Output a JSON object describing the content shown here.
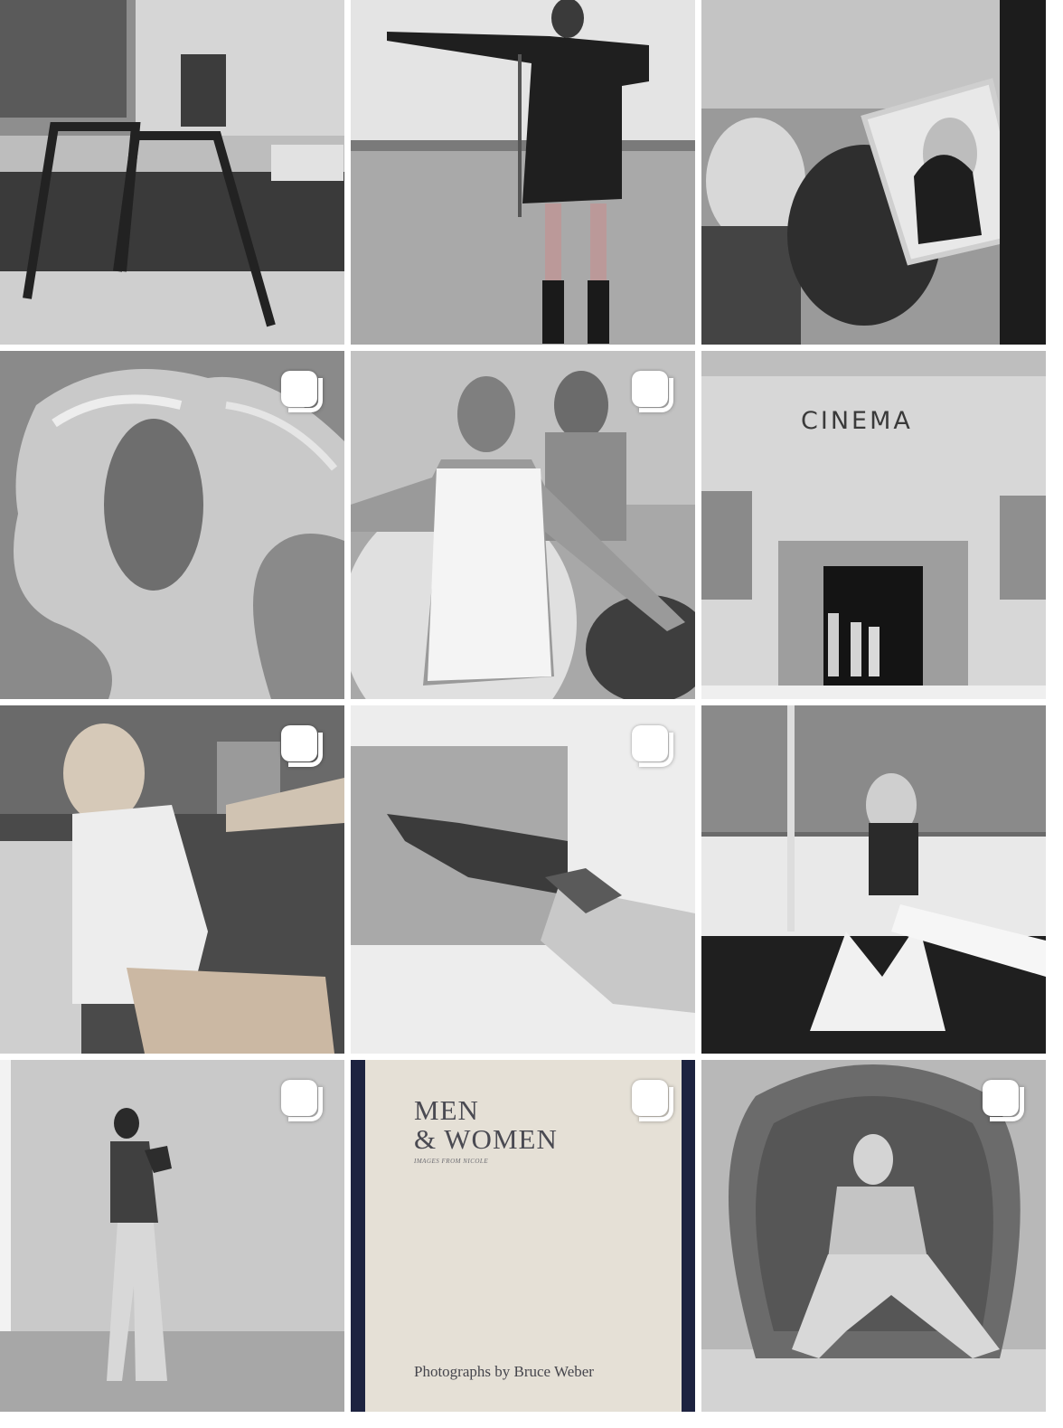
{
  "grid": {
    "tiles": [
      {
        "name": "photo-pool-ladder",
        "carousel": false
      },
      {
        "name": "photo-woman-field",
        "carousel": false
      },
      {
        "name": "photo-film-set-mirror",
        "carousel": false
      },
      {
        "name": "photo-sculpture",
        "carousel": true
      },
      {
        "name": "photo-pool-float",
        "carousel": true
      },
      {
        "name": "photo-cinema-facade",
        "carousel": false
      },
      {
        "name": "photo-woman-chair",
        "carousel": true
      },
      {
        "name": "photo-hands",
        "carousel": true
      },
      {
        "name": "photo-splash",
        "carousel": false
      },
      {
        "name": "photo-man-wall",
        "carousel": true
      },
      {
        "name": "photo-book-cover",
        "carousel": true
      },
      {
        "name": "photo-wicker-chair",
        "carousel": true
      }
    ]
  },
  "cinema": {
    "sign": "CINEMA"
  },
  "book": {
    "title_line1": "MEN",
    "title_line2": "& WOMEN",
    "subtitle": "IMAGES FROM NICOLE",
    "credit": "Photographs by Bruce Weber"
  },
  "icons": {
    "carousel": "carousel-icon"
  }
}
